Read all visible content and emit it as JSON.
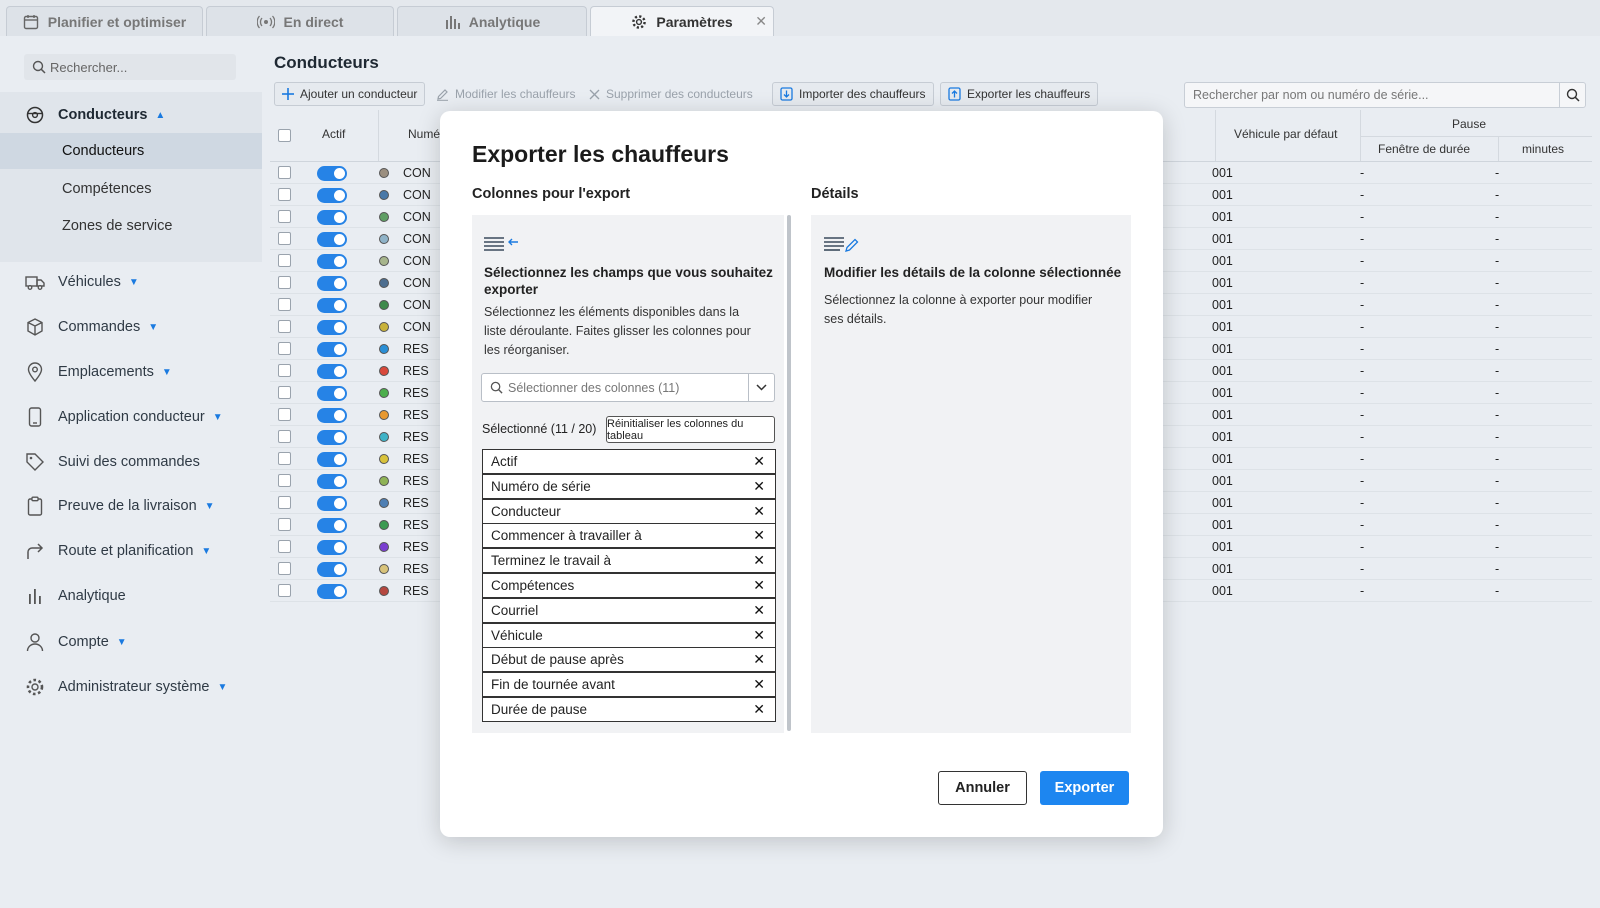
{
  "tabs": [
    {
      "label": "Planifier et optimiser",
      "icon": "calendar-icon"
    },
    {
      "label": "En direct",
      "icon": "broadcast-icon"
    },
    {
      "label": "Analytique",
      "icon": "bar-chart-icon"
    },
    {
      "label": "Paramètres",
      "icon": "gear-icon",
      "active": true
    }
  ],
  "sidebar": {
    "search_placeholder": "Rechercher...",
    "group": {
      "label": "Conducteurs",
      "icon": "driver-icon"
    },
    "sub_items": [
      {
        "label": "Conducteurs",
        "selected": true
      },
      {
        "label": "Compétences"
      },
      {
        "label": "Zones de service"
      }
    ],
    "items": [
      {
        "label": "Véhicules",
        "icon": "truck-icon",
        "caret": true
      },
      {
        "label": "Commandes",
        "icon": "box-icon",
        "caret": true
      },
      {
        "label": "Emplacements",
        "icon": "location-pin-icon",
        "caret": true
      },
      {
        "label": "Application conducteur",
        "icon": "phone-icon",
        "caret": true
      },
      {
        "label": "Suivi des commandes",
        "icon": "tag-icon",
        "caret": false
      },
      {
        "label": "Preuve de la livraison",
        "icon": "clipboard-icon",
        "caret": true
      },
      {
        "label": "Route et planification",
        "icon": "route-arrow-icon",
        "caret": true
      },
      {
        "label": "Analytique",
        "icon": "bar-chart-icon",
        "caret": false
      },
      {
        "label": "Compte",
        "icon": "user-icon",
        "caret": true
      },
      {
        "label": "Administrateur système",
        "icon": "gear-icon",
        "caret": true
      }
    ]
  },
  "page": {
    "title": "Conducteurs"
  },
  "toolbar": {
    "add": "Ajouter un conducteur",
    "edit": "Modifier les chauffeurs",
    "delete": "Supprimer des conducteurs",
    "import": "Importer des chauffeurs",
    "export": "Exporter les chauffeurs",
    "search_placeholder": "Rechercher par nom ou numéro de série..."
  },
  "table": {
    "headers": {
      "active": "Actif",
      "number": "Numé",
      "vehicle": "Véhicule par défaut",
      "pause": "Pause",
      "window": "Fenêtre de durée",
      "minutes": "minutes"
    },
    "rows": [
      {
        "code": "CON",
        "color": "#9b8f80",
        "vehicle": "001",
        "window": "-",
        "minutes": "-"
      },
      {
        "code": "CON",
        "color": "#4a79a8",
        "vehicle": "001",
        "window": "-",
        "minutes": "-"
      },
      {
        "code": "CON",
        "color": "#5f9e64",
        "vehicle": "001",
        "window": "-",
        "minutes": "-"
      },
      {
        "code": "CON",
        "color": "#8fb3c8",
        "vehicle": "001",
        "window": "-",
        "minutes": "-"
      },
      {
        "code": "CON",
        "color": "#a7b58c",
        "vehicle": "001",
        "window": "-",
        "minutes": "-"
      },
      {
        "code": "CON",
        "color": "#4d6e8f",
        "vehicle": "001",
        "window": "-",
        "minutes": "-"
      },
      {
        "code": "CON",
        "color": "#3f8a4c",
        "vehicle": "001",
        "window": "-",
        "minutes": "-"
      },
      {
        "code": "CON",
        "color": "#c8b23a",
        "vehicle": "001",
        "window": "-",
        "minutes": "-"
      },
      {
        "code": "RES",
        "color": "#2a8fd6",
        "vehicle": "001",
        "window": "-",
        "minutes": "-"
      },
      {
        "code": "RES",
        "color": "#d9493b",
        "vehicle": "001",
        "window": "-",
        "minutes": "-"
      },
      {
        "code": "RES",
        "color": "#4cae4c",
        "vehicle": "001",
        "window": "-",
        "minutes": "-"
      },
      {
        "code": "RES",
        "color": "#e8982f",
        "vehicle": "001",
        "window": "-",
        "minutes": "-"
      },
      {
        "code": "RES",
        "color": "#3fb3c7",
        "vehicle": "001",
        "window": "-",
        "minutes": "-"
      },
      {
        "code": "RES",
        "color": "#d8c23b",
        "vehicle": "001",
        "window": "-",
        "minutes": "-"
      },
      {
        "code": "RES",
        "color": "#8fb356",
        "vehicle": "001",
        "window": "-",
        "minutes": "-"
      },
      {
        "code": "RES",
        "color": "#4e7fb3",
        "vehicle": "001",
        "window": "-",
        "minutes": "-"
      },
      {
        "code": "RES",
        "color": "#3c9a52",
        "vehicle": "001",
        "window": "-",
        "minutes": "-"
      },
      {
        "code": "RES",
        "color": "#7a3fd0",
        "vehicle": "001",
        "window": "-",
        "minutes": "-"
      },
      {
        "code": "RES",
        "color": "#d8c37a",
        "vehicle": "001",
        "window": "-",
        "minutes": "-"
      },
      {
        "code": "RES",
        "color": "#b5473f",
        "vehicle": "001",
        "window": "-",
        "minutes": "-"
      }
    ]
  },
  "modal": {
    "title": "Exporter les chauffeurs",
    "columns_heading": "Colonnes pour l'export",
    "details_heading": "Détails",
    "left_title": "Sélectionnez les champs que vous souhaitez exporter",
    "left_text": "Sélectionnez les éléments disponibles dans la liste déroulante. Faites glisser les colonnes pour les réorganiser.",
    "select_placeholder": "Sélectionner des colonnes (11)",
    "selected_count": "Sélectionné (11 / 20)",
    "reset_label": "Réinitialiser les colonnes du tableau",
    "chips": [
      "Actif",
      "Numéro de série",
      "Conducteur",
      "Commencer à travailler à",
      "Terminez le travail à",
      "Compétences",
      "Courriel",
      "Véhicule",
      "Début de pause après",
      "Fin de tournée avant",
      "Durée de pause"
    ],
    "right_title": "Modifier les détails de la colonne sélectionnée",
    "right_text": "Sélectionnez la colonne à exporter pour modifier ses détails.",
    "cancel": "Annuler",
    "export": "Exporter"
  },
  "colors": {
    "accent": "#1d86f0",
    "toggle": "#2683e6"
  }
}
